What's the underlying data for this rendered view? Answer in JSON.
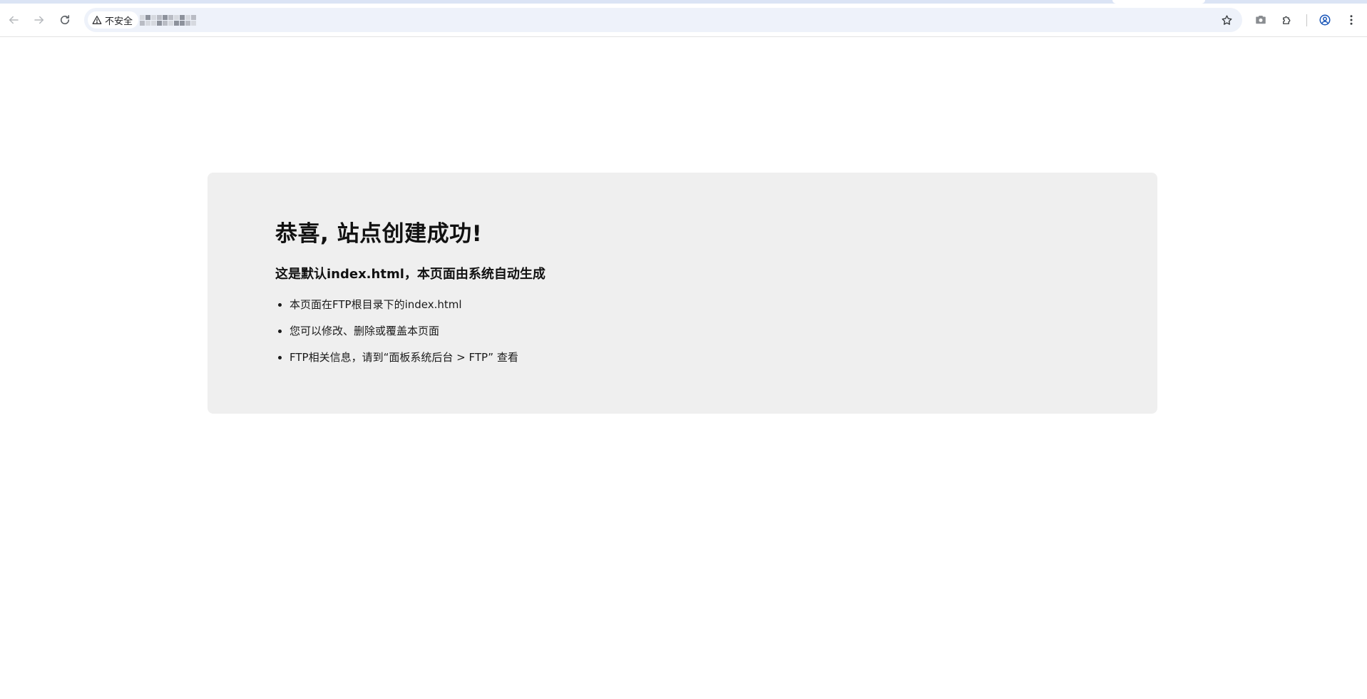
{
  "browser": {
    "security_label": "不安全",
    "nav": {
      "back_icon": "arrow-left-icon",
      "forward_icon": "arrow-right-icon",
      "reload_icon": "reload-icon"
    },
    "toolbar_icons": [
      "star-icon",
      "camera-icon",
      "extensions-icon",
      "profile-icon",
      "more-vert-icon"
    ]
  },
  "page": {
    "title": "恭喜, 站点创建成功!",
    "subtitle": "这是默认index.html，本页面由系统自动生成",
    "items": [
      {
        "text": "本页面在FTP根目录下的index.html"
      },
      {
        "text": "您可以修改、删除或覆盖本页面"
      },
      {
        "text": "FTP相关信息，请到“面板系统后台 > FTP” 查看"
      }
    ]
  },
  "colors": {
    "card_background": "#efefef",
    "omnibox_background": "#eef2fa",
    "tab_strip": "#dbe4f5",
    "profile_accent": "#1a56b8"
  }
}
